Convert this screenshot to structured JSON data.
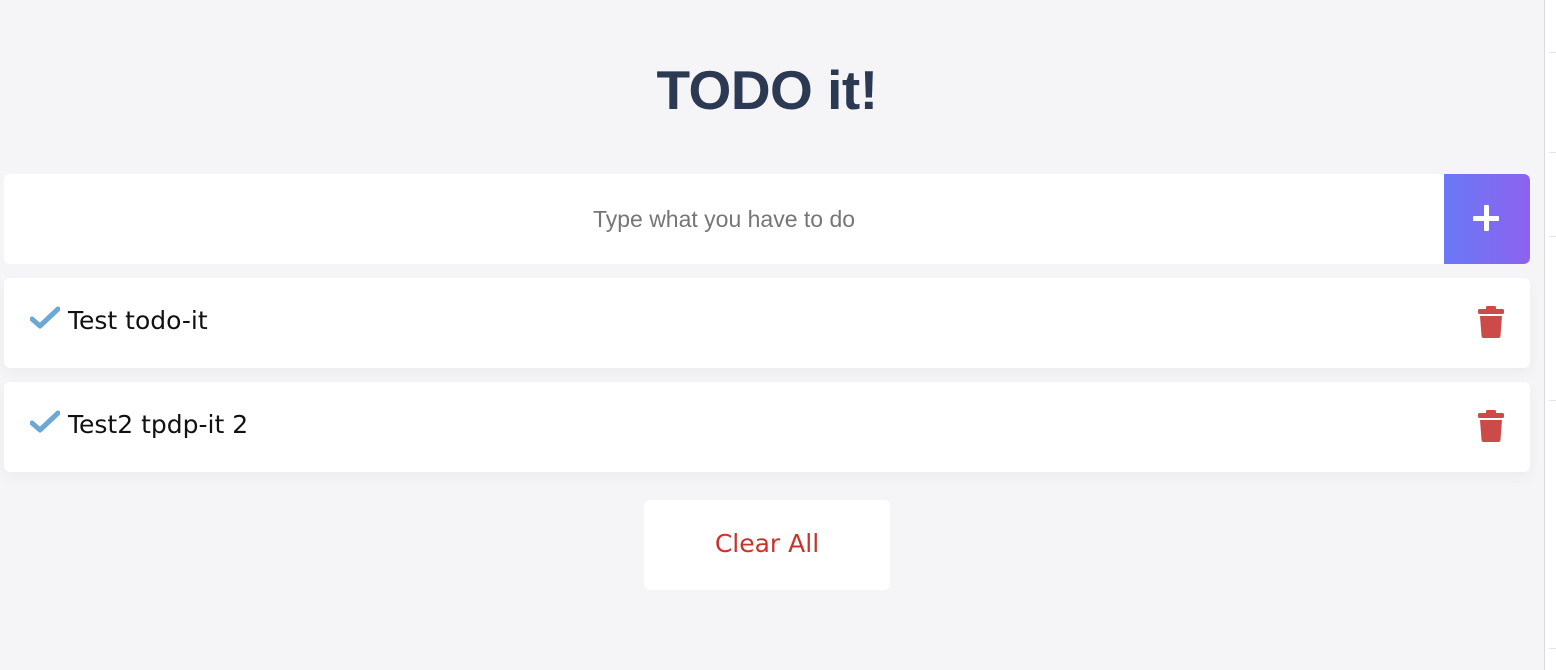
{
  "app": {
    "title": "TODO it!"
  },
  "input": {
    "placeholder": "Type what you have to do",
    "value": ""
  },
  "add_button": {
    "icon": "plus-icon"
  },
  "todos": [
    {
      "text": "Test todo-it",
      "check_icon": "check-icon",
      "delete_icon": "trash-icon"
    },
    {
      "text": "Test2 tpdp-it 2",
      "check_icon": "check-icon",
      "delete_icon": "trash-icon"
    }
  ],
  "clear_button": {
    "label": "Clear All"
  },
  "colors": {
    "title": "#2c3952",
    "accent_gradient_start": "#6a78f5",
    "accent_gradient_end": "#8c63f0",
    "check": "#6ca8d6",
    "delete": "#cc4b48",
    "clear_text": "#c8342a",
    "background": "#f5f5f8"
  }
}
